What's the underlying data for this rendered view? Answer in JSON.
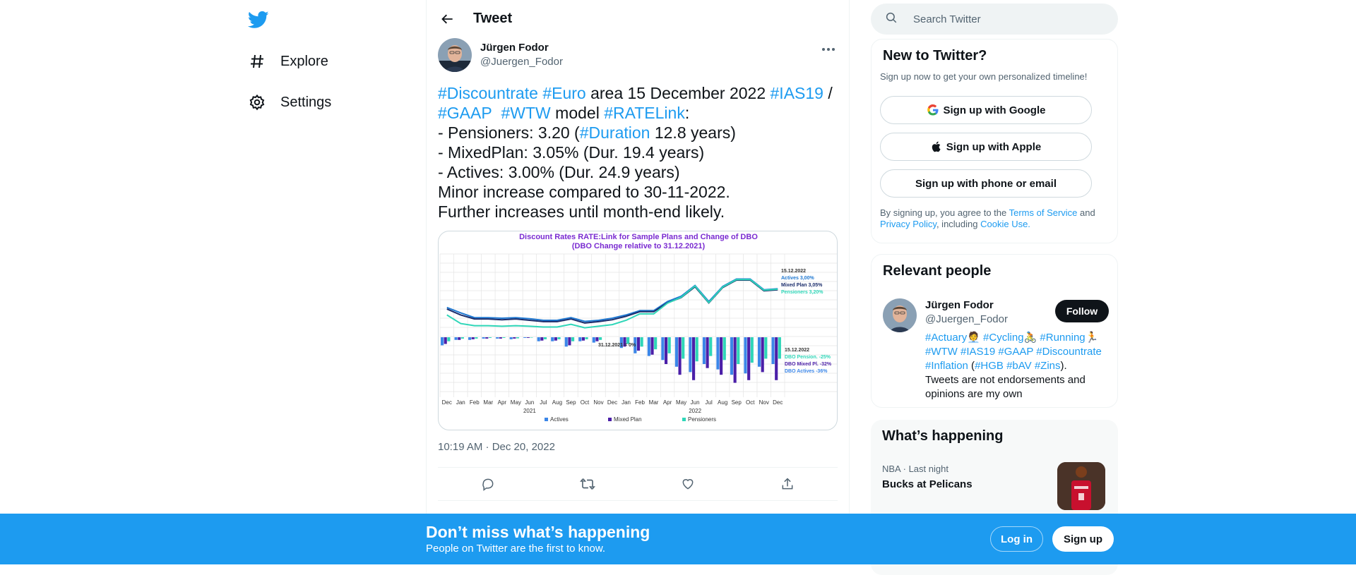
{
  "nav": {
    "logo": "twitter-bird",
    "items": [
      {
        "label": "Explore",
        "icon": "hashtag-icon"
      },
      {
        "label": "Settings",
        "icon": "gear-icon"
      }
    ]
  },
  "header": {
    "title": "Tweet"
  },
  "tweet": {
    "author": {
      "name": "Jürgen Fodor",
      "handle": "@Juergen_Fodor"
    },
    "line1": {
      "h1": "#Discountrate",
      "h2": "#Euro",
      "t1": " area 15 December 2022 ",
      "h3": "#IAS19",
      "t2": " /"
    },
    "line2": {
      "h1": "#GAAP",
      "h2": "#WTW",
      "t1": " model ",
      "h3": "#RATELink",
      "t2": ":"
    },
    "line3": {
      "t1": "- Pensioners: 3.20 (",
      "h1": "#Duration",
      "t2": " 12.8 years)"
    },
    "line4": "- MixedPlan: 3.05% (Dur. 19.4 years)",
    "line5": "- Actives: 3.00% (Dur. 24.9 years)",
    "line6": "Minor increase compared to 30-11-2022.",
    "line7": "Further increases until month-end likely.",
    "timestamp": "10:19 AM · Dec 20, 2022"
  },
  "chart_data": {
    "type": "bar",
    "title": "Discount Rates RATE:Link for Sample Plans and Change of DBO",
    "subtitle": "(DBO Change relative to 31.12.2021)",
    "categories": [
      "Dec",
      "Jan",
      "Feb",
      "Mar",
      "Apr",
      "May",
      "Jun",
      "Jul",
      "Aug",
      "Sep",
      "Oct",
      "Nov",
      "Dec",
      "Jan",
      "Feb",
      "Mar",
      "Apr",
      "May",
      "Jun",
      "Jul",
      "Aug",
      "Sep",
      "Oct",
      "Nov",
      "Dec"
    ],
    "year_labels": [
      "2021",
      "2022"
    ],
    "bar_series": [
      {
        "name": "Actives",
        "color": "#3b86e8",
        "values": [
          -0.06,
          -0.02,
          -0.02,
          -0.01,
          -0.01,
          -0.015,
          -0.005,
          -0.03,
          -0.03,
          -0.07,
          -0.03,
          -0.04,
          0.0,
          -0.08,
          -0.12,
          -0.14,
          -0.17,
          -0.22,
          -0.26,
          -0.2,
          -0.24,
          -0.28,
          -0.27,
          -0.22,
          -0.2
        ]
      },
      {
        "name": "Mixed Plan",
        "color": "#4b1fa8",
        "values": [
          -0.05,
          -0.02,
          -0.015,
          -0.01,
          -0.01,
          -0.01,
          -0.005,
          -0.025,
          -0.025,
          -0.06,
          -0.025,
          -0.03,
          0.0,
          -0.07,
          -0.1,
          -0.13,
          -0.2,
          -0.28,
          -0.32,
          -0.23,
          -0.28,
          -0.34,
          -0.32,
          -0.26,
          -0.32
        ]
      },
      {
        "name": "Pensioners",
        "color": "#2fd6b8",
        "values": [
          -0.03,
          -0.01,
          -0.01,
          -0.005,
          -0.005,
          -0.008,
          -0.003,
          -0.015,
          -0.015,
          -0.03,
          -0.015,
          -0.02,
          0.0,
          -0.05,
          -0.07,
          -0.09,
          -0.12,
          -0.16,
          -0.18,
          -0.14,
          -0.17,
          -0.2,
          -0.19,
          -0.16,
          -0.16
        ]
      }
    ],
    "line_series": [
      {
        "name": "Actives",
        "color": "#1f78d1",
        "values": [
          0.98,
          0.78,
          0.6,
          0.6,
          0.58,
          0.6,
          0.56,
          0.5,
          0.5,
          0.6,
          0.46,
          0.5,
          0.58,
          0.7,
          0.86,
          0.86,
          1.2,
          1.4,
          1.8,
          1.2,
          1.76,
          2.04,
          2.04,
          1.64,
          1.68
        ]
      },
      {
        "name": "Mixed Plan",
        "color": "#1b2d6b",
        "values": [
          0.92,
          0.7,
          0.55,
          0.55,
          0.52,
          0.55,
          0.5,
          0.45,
          0.45,
          0.55,
          0.4,
          0.45,
          0.52,
          0.65,
          0.82,
          0.82,
          1.15,
          1.35,
          1.75,
          1.15,
          1.72,
          2.0,
          2.0,
          1.6,
          1.64
        ]
      },
      {
        "name": "Pensioners",
        "color": "#2fd6b8",
        "values": [
          0.7,
          0.38,
          0.3,
          0.3,
          0.28,
          0.3,
          0.28,
          0.25,
          0.25,
          0.35,
          0.22,
          0.28,
          0.34,
          0.5,
          0.74,
          0.74,
          1.14,
          1.36,
          1.78,
          1.16,
          1.74,
          2.02,
          2.02,
          1.62,
          1.66
        ]
      }
    ],
    "annotations": {
      "date_label": "15.12.2022",
      "actives_rate": "Actives 3,00%",
      "mixed_rate": "Mixed Plan 3,05%",
      "pension_rate": "Pensioners 3,20%",
      "zero_label": "31.12.2021 = 0%",
      "dbo_date": "15.12.2022",
      "dbo_pension": "DBO Pension. -25%",
      "dbo_mixed": "DBO Mixed Pl. -32%",
      "dbo_actives": "DBO Actives -36%"
    },
    "legend": [
      "Actives",
      "Mixed Plan",
      "Pensioners"
    ],
    "legend_position": "bottom"
  },
  "right": {
    "search_placeholder": "Search Twitter",
    "new_to": {
      "title": "New to Twitter?",
      "subtitle": "Sign up now to get your own personalized timeline!",
      "google": "Sign up with Google",
      "apple": "Sign up with Apple",
      "phone": "Sign up with phone or email",
      "legal_1": "By signing up, you agree to the ",
      "terms": "Terms of Service",
      "legal_2": " and",
      "privacy": "Privacy Policy",
      "legal_3": ", including ",
      "cookie": "Cookie Use."
    },
    "relevant": {
      "title": "Relevant people",
      "name": "Jürgen Fodor",
      "handle": "@Juergen_Fodor",
      "follow": "Follow",
      "bio_tags_1": "#Actuary🧑‍💼 #Cycling🚴 #Running🏃",
      "bio_tags_2": "#WTW #IAS19 #GAAP #Discountrate",
      "bio_tags_3a": "#Inflation",
      "bio_tags_3b": " (",
      "bio_tags_3c": "#HGB #bAV #Zins",
      "bio_tags_3d": ").",
      "bio_text": "Tweets are not endorsements and opinions are my own"
    },
    "happening": {
      "title": "What’s happening",
      "meta": "NBA · Last night",
      "trend": "Bucks at Pelicans"
    }
  },
  "bottom": {
    "headline": "Don’t miss what’s happening",
    "sub": "People on Twitter are the first to know.",
    "login": "Log in",
    "signup": "Sign up"
  }
}
